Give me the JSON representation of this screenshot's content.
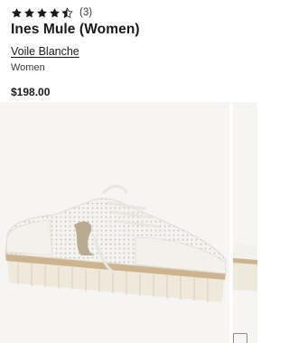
{
  "product": {
    "rating": 4.5,
    "review_count": "(3)",
    "title": "Ines Mule (Women)",
    "brand": "Voile Blanche",
    "category": "Women",
    "price": "$198.00"
  },
  "icons": {
    "star": "star-icon",
    "half_star": "star-half-icon"
  },
  "colors": {
    "text": "#191919",
    "star_fill": "#191919",
    "image_bg": "#f6f5f3"
  },
  "gallery": {
    "image_count_visible": 2
  }
}
